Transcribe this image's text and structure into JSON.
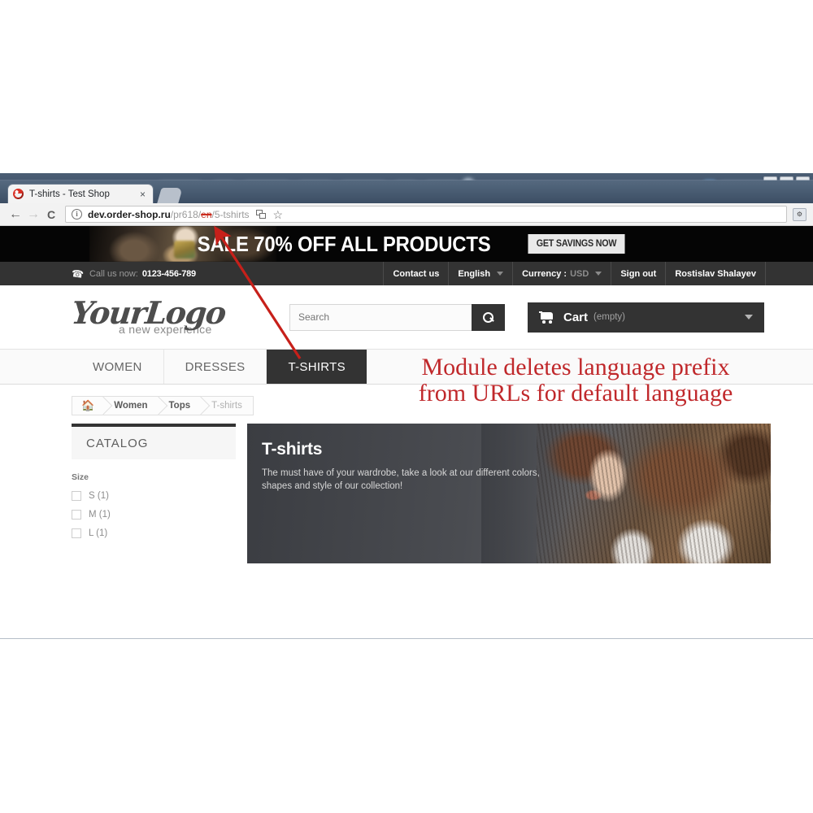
{
  "background_window": {
    "name": "blurred-background-window"
  },
  "browser": {
    "tab": {
      "title": "T-shirts - Test Shop",
      "close_label": "×"
    },
    "nav": {
      "back": "←",
      "forward": "→",
      "reload": "⟳"
    },
    "omnibox": {
      "info_glyph": "i",
      "url_prefix": "dev.order-shop.ru",
      "url_mid": "/pr618/",
      "url_strike": "en",
      "url_suffix": "/5-tshirts"
    },
    "window_buttons": [
      "—",
      "❐",
      "×"
    ]
  },
  "promo": {
    "headline": "SALE 70% OFF ALL PRODUCTS",
    "button": "GET SAVINGS NOW"
  },
  "topnav": {
    "call_label": "Call us now:",
    "phone": "0123-456-789",
    "items": [
      {
        "label": "Contact us",
        "caret": false
      },
      {
        "label": "English",
        "caret": true
      },
      {
        "label": "Currency :",
        "value": "USD",
        "caret": true
      },
      {
        "label": "Sign out",
        "caret": false
      },
      {
        "label": "Rostislav Shalayev",
        "caret": false
      }
    ]
  },
  "header": {
    "logo_main": "YourLogo",
    "logo_sub": "a new experience",
    "search_placeholder": "Search",
    "search_value": "",
    "cart_label": "Cart",
    "cart_status": "(empty)"
  },
  "mainnav": {
    "tabs": [
      {
        "label": "WOMEN",
        "active": false
      },
      {
        "label": "DRESSES",
        "active": false
      },
      {
        "label": "T-SHIRTS",
        "active": true
      }
    ]
  },
  "annotation": {
    "line1": "Module deletes language prefix",
    "line2": "from URLs for default language",
    "color": "#c0282b"
  },
  "breadcrumb": {
    "home_glyph": "⌂",
    "items": [
      "Women",
      "Tops",
      "T-shirts"
    ]
  },
  "sidebar": {
    "catalog_title": "CATALOG",
    "filter_label": "Size",
    "filters": [
      {
        "label": "S (1)",
        "checked": false
      },
      {
        "label": "M (1)",
        "checked": false
      },
      {
        "label": "L (1)",
        "checked": false
      }
    ]
  },
  "hero": {
    "title": "T-shirts",
    "description": "The must have of your wardrobe, take a look at our different colors, shapes and style of our collection!"
  }
}
